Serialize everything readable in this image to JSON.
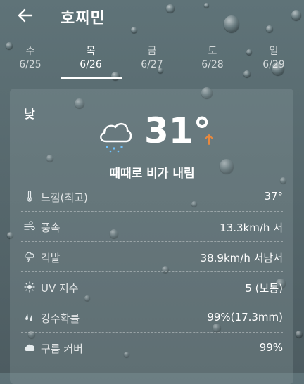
{
  "header": {
    "title": "호찌민"
  },
  "tabs": [
    {
      "day": "수",
      "date": "6/25"
    },
    {
      "day": "목",
      "date": "6/26"
    },
    {
      "day": "금",
      "date": "6/27"
    },
    {
      "day": "토",
      "date": "6/28"
    },
    {
      "day": "일",
      "date": "6/29"
    }
  ],
  "active_tab_index": 1,
  "forecast": {
    "period": "낮",
    "temperature": "31°",
    "condition": "때때로 비가 내림",
    "trend_icon": "arrow-up-icon",
    "trend_color": "#e8893f"
  },
  "details": [
    {
      "icon": "thermometer-icon",
      "label": "느낌(최고)",
      "value": "37°"
    },
    {
      "icon": "wind-icon",
      "label": "풍속",
      "value": "13.3km/h 서"
    },
    {
      "icon": "gust-icon",
      "label": "격발",
      "value": "38.9km/h 서남서"
    },
    {
      "icon": "sun-icon",
      "label": "UV 지수",
      "value": "5 (보통)"
    },
    {
      "icon": "rain-drops-icon",
      "label": "강수확률",
      "value": "99%(17.3mm)"
    },
    {
      "icon": "cloud-icon",
      "label": "구름 커버",
      "value": "99%"
    }
  ]
}
